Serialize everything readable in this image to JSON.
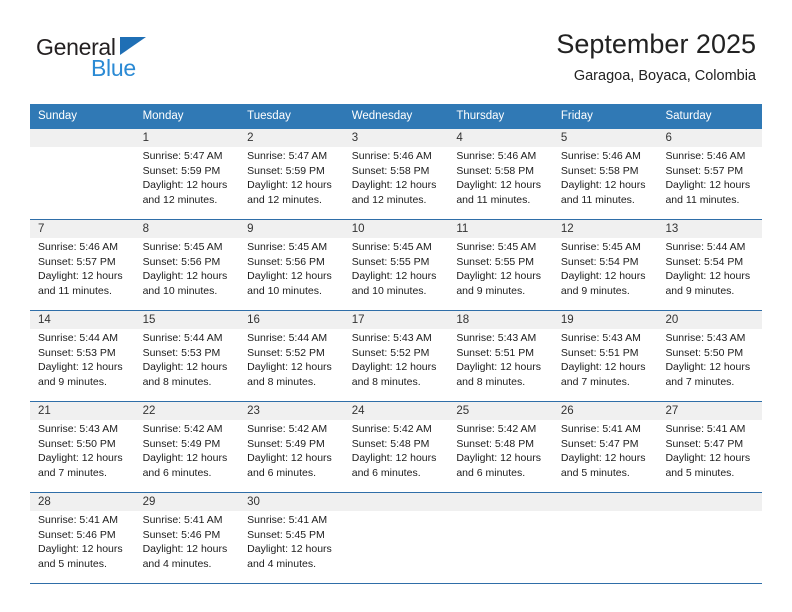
{
  "brand": {
    "name_part1": "General",
    "name_part2": "Blue",
    "accent_color": "#2b8ad4",
    "triangle_color": "#1f6fb5"
  },
  "header": {
    "title": "September 2025",
    "subtitle": "Garagoa, Boyaca, Colombia",
    "header_bg": "#3079b5",
    "band_bg": "#f0f0f0"
  },
  "weekdays": [
    "Sunday",
    "Monday",
    "Tuesday",
    "Wednesday",
    "Thursday",
    "Friday",
    "Saturday"
  ],
  "weeks": [
    [
      {
        "day": "",
        "sunrise": "",
        "sunset": "",
        "daylight1": "",
        "daylight2": ""
      },
      {
        "day": "1",
        "sunrise": "Sunrise: 5:47 AM",
        "sunset": "Sunset: 5:59 PM",
        "daylight1": "Daylight: 12 hours",
        "daylight2": "and 12 minutes."
      },
      {
        "day": "2",
        "sunrise": "Sunrise: 5:47 AM",
        "sunset": "Sunset: 5:59 PM",
        "daylight1": "Daylight: 12 hours",
        "daylight2": "and 12 minutes."
      },
      {
        "day": "3",
        "sunrise": "Sunrise: 5:46 AM",
        "sunset": "Sunset: 5:58 PM",
        "daylight1": "Daylight: 12 hours",
        "daylight2": "and 12 minutes."
      },
      {
        "day": "4",
        "sunrise": "Sunrise: 5:46 AM",
        "sunset": "Sunset: 5:58 PM",
        "daylight1": "Daylight: 12 hours",
        "daylight2": "and 11 minutes."
      },
      {
        "day": "5",
        "sunrise": "Sunrise: 5:46 AM",
        "sunset": "Sunset: 5:58 PM",
        "daylight1": "Daylight: 12 hours",
        "daylight2": "and 11 minutes."
      },
      {
        "day": "6",
        "sunrise": "Sunrise: 5:46 AM",
        "sunset": "Sunset: 5:57 PM",
        "daylight1": "Daylight: 12 hours",
        "daylight2": "and 11 minutes."
      }
    ],
    [
      {
        "day": "7",
        "sunrise": "Sunrise: 5:46 AM",
        "sunset": "Sunset: 5:57 PM",
        "daylight1": "Daylight: 12 hours",
        "daylight2": "and 11 minutes."
      },
      {
        "day": "8",
        "sunrise": "Sunrise: 5:45 AM",
        "sunset": "Sunset: 5:56 PM",
        "daylight1": "Daylight: 12 hours",
        "daylight2": "and 10 minutes."
      },
      {
        "day": "9",
        "sunrise": "Sunrise: 5:45 AM",
        "sunset": "Sunset: 5:56 PM",
        "daylight1": "Daylight: 12 hours",
        "daylight2": "and 10 minutes."
      },
      {
        "day": "10",
        "sunrise": "Sunrise: 5:45 AM",
        "sunset": "Sunset: 5:55 PM",
        "daylight1": "Daylight: 12 hours",
        "daylight2": "and 10 minutes."
      },
      {
        "day": "11",
        "sunrise": "Sunrise: 5:45 AM",
        "sunset": "Sunset: 5:55 PM",
        "daylight1": "Daylight: 12 hours",
        "daylight2": "and 9 minutes."
      },
      {
        "day": "12",
        "sunrise": "Sunrise: 5:45 AM",
        "sunset": "Sunset: 5:54 PM",
        "daylight1": "Daylight: 12 hours",
        "daylight2": "and 9 minutes."
      },
      {
        "day": "13",
        "sunrise": "Sunrise: 5:44 AM",
        "sunset": "Sunset: 5:54 PM",
        "daylight1": "Daylight: 12 hours",
        "daylight2": "and 9 minutes."
      }
    ],
    [
      {
        "day": "14",
        "sunrise": "Sunrise: 5:44 AM",
        "sunset": "Sunset: 5:53 PM",
        "daylight1": "Daylight: 12 hours",
        "daylight2": "and 9 minutes."
      },
      {
        "day": "15",
        "sunrise": "Sunrise: 5:44 AM",
        "sunset": "Sunset: 5:53 PM",
        "daylight1": "Daylight: 12 hours",
        "daylight2": "and 8 minutes."
      },
      {
        "day": "16",
        "sunrise": "Sunrise: 5:44 AM",
        "sunset": "Sunset: 5:52 PM",
        "daylight1": "Daylight: 12 hours",
        "daylight2": "and 8 minutes."
      },
      {
        "day": "17",
        "sunrise": "Sunrise: 5:43 AM",
        "sunset": "Sunset: 5:52 PM",
        "daylight1": "Daylight: 12 hours",
        "daylight2": "and 8 minutes."
      },
      {
        "day": "18",
        "sunrise": "Sunrise: 5:43 AM",
        "sunset": "Sunset: 5:51 PM",
        "daylight1": "Daylight: 12 hours",
        "daylight2": "and 8 minutes."
      },
      {
        "day": "19",
        "sunrise": "Sunrise: 5:43 AM",
        "sunset": "Sunset: 5:51 PM",
        "daylight1": "Daylight: 12 hours",
        "daylight2": "and 7 minutes."
      },
      {
        "day": "20",
        "sunrise": "Sunrise: 5:43 AM",
        "sunset": "Sunset: 5:50 PM",
        "daylight1": "Daylight: 12 hours",
        "daylight2": "and 7 minutes."
      }
    ],
    [
      {
        "day": "21",
        "sunrise": "Sunrise: 5:43 AM",
        "sunset": "Sunset: 5:50 PM",
        "daylight1": "Daylight: 12 hours",
        "daylight2": "and 7 minutes."
      },
      {
        "day": "22",
        "sunrise": "Sunrise: 5:42 AM",
        "sunset": "Sunset: 5:49 PM",
        "daylight1": "Daylight: 12 hours",
        "daylight2": "and 6 minutes."
      },
      {
        "day": "23",
        "sunrise": "Sunrise: 5:42 AM",
        "sunset": "Sunset: 5:49 PM",
        "daylight1": "Daylight: 12 hours",
        "daylight2": "and 6 minutes."
      },
      {
        "day": "24",
        "sunrise": "Sunrise: 5:42 AM",
        "sunset": "Sunset: 5:48 PM",
        "daylight1": "Daylight: 12 hours",
        "daylight2": "and 6 minutes."
      },
      {
        "day": "25",
        "sunrise": "Sunrise: 5:42 AM",
        "sunset": "Sunset: 5:48 PM",
        "daylight1": "Daylight: 12 hours",
        "daylight2": "and 6 minutes."
      },
      {
        "day": "26",
        "sunrise": "Sunrise: 5:41 AM",
        "sunset": "Sunset: 5:47 PM",
        "daylight1": "Daylight: 12 hours",
        "daylight2": "and 5 minutes."
      },
      {
        "day": "27",
        "sunrise": "Sunrise: 5:41 AM",
        "sunset": "Sunset: 5:47 PM",
        "daylight1": "Daylight: 12 hours",
        "daylight2": "and 5 minutes."
      }
    ],
    [
      {
        "day": "28",
        "sunrise": "Sunrise: 5:41 AM",
        "sunset": "Sunset: 5:46 PM",
        "daylight1": "Daylight: 12 hours",
        "daylight2": "and 5 minutes."
      },
      {
        "day": "29",
        "sunrise": "Sunrise: 5:41 AM",
        "sunset": "Sunset: 5:46 PM",
        "daylight1": "Daylight: 12 hours",
        "daylight2": "and 4 minutes."
      },
      {
        "day": "30",
        "sunrise": "Sunrise: 5:41 AM",
        "sunset": "Sunset: 5:45 PM",
        "daylight1": "Daylight: 12 hours",
        "daylight2": "and 4 minutes."
      },
      {
        "day": "",
        "sunrise": "",
        "sunset": "",
        "daylight1": "",
        "daylight2": ""
      },
      {
        "day": "",
        "sunrise": "",
        "sunset": "",
        "daylight1": "",
        "daylight2": ""
      },
      {
        "day": "",
        "sunrise": "",
        "sunset": "",
        "daylight1": "",
        "daylight2": ""
      },
      {
        "day": "",
        "sunrise": "",
        "sunset": "",
        "daylight1": "",
        "daylight2": ""
      }
    ]
  ]
}
